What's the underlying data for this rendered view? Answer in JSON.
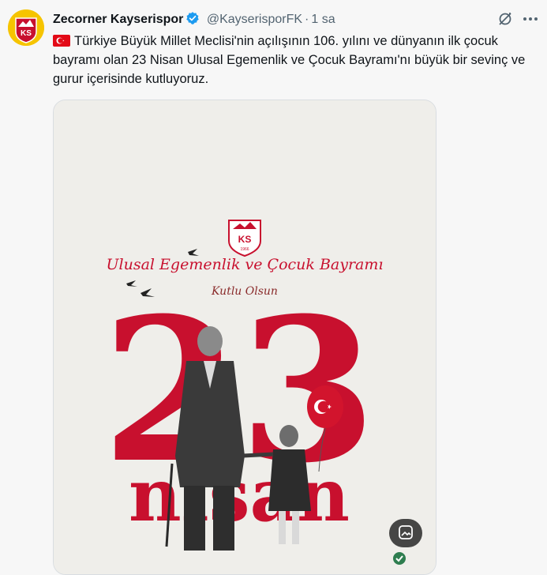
{
  "tweet": {
    "author_name": "Zecorner Kayserispor",
    "handle": "@KayserisporFK",
    "separator": "·",
    "time": "1 sa",
    "text": "Türkiye Büyük Millet Meclisi'nin açılışının 106. yılını ve dünyanın ilk çocuk bayramı olan 23 Nisan Ulusal Egemenlik ve Çocuk Bayramı'nı büyük bir sevinç ve gurur içerisinde kutluyoruz.",
    "more_label": "···"
  },
  "avatar": {
    "logo_text": "KS"
  },
  "media": {
    "logo_text": "KS",
    "logo_year": "1966",
    "title": "Ulusal Egemenlik ve Çocuk Bayramı",
    "subtitle": "Kutlu Olsun",
    "big_number": "23",
    "word": "nisan"
  },
  "colors": {
    "accent_red": "#c8102e",
    "verified_blue": "#1d9bf0",
    "muted_text": "#536471",
    "yellow": "#f6c400"
  },
  "icons": [
    "turkish-flag-icon",
    "verified-badge-icon",
    "grok-icon",
    "more-icon",
    "image-edit-icon",
    "check-icon"
  ]
}
